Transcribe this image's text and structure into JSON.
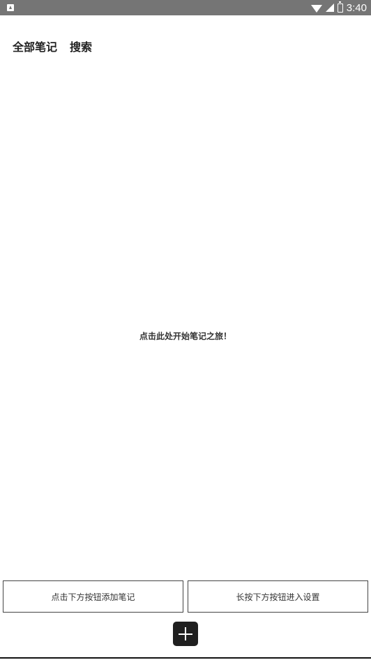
{
  "status_bar": {
    "time": "3:40",
    "icons": [
      "notification-icon",
      "wifi-icon",
      "signal-icon",
      "battery-icon"
    ]
  },
  "header": {
    "tabs": [
      {
        "label": "全部笔记"
      },
      {
        "label": "搜索"
      }
    ]
  },
  "main": {
    "empty_hint": "点击此处开始笔记之旅！"
  },
  "footer": {
    "hint_left": "点击下方按钮添加笔记",
    "hint_right": "长按下方按钮进入设置",
    "fab_icon": "plus-icon"
  },
  "colors": {
    "status_bar": "#757575",
    "background": "#ffffff",
    "fab": "#1f1f1f",
    "text": "#222222"
  }
}
